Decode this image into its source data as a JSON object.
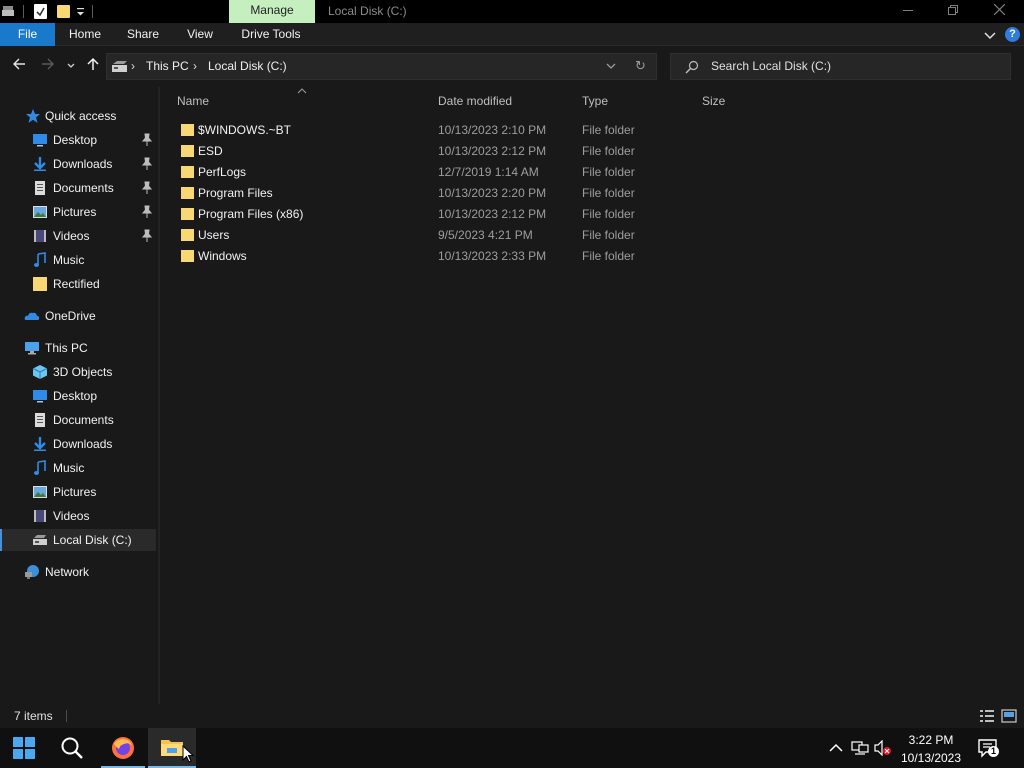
{
  "titlebar": {
    "manage_tab": "Manage",
    "window_title": "Local Disk (C:)"
  },
  "ribbon": {
    "tabs": [
      "File",
      "Home",
      "Share",
      "View",
      "Drive Tools"
    ],
    "help": "?"
  },
  "address": {
    "crumbs": [
      "This PC",
      "Local Disk (C:)"
    ],
    "search_placeholder": "Search Local Disk (C:)"
  },
  "sidebar": {
    "quick_access": "Quick access",
    "quick_items": [
      {
        "label": "Desktop",
        "icon": "desktop-icon",
        "pinned": true
      },
      {
        "label": "Downloads",
        "icon": "downloads-icon",
        "pinned": true
      },
      {
        "label": "Documents",
        "icon": "documents-icon",
        "pinned": true
      },
      {
        "label": "Pictures",
        "icon": "pictures-icon",
        "pinned": true
      },
      {
        "label": "Videos",
        "icon": "videos-icon",
        "pinned": true
      },
      {
        "label": "Music",
        "icon": "music-icon",
        "pinned": false
      },
      {
        "label": "Rectified",
        "icon": "folder-icon",
        "pinned": false
      }
    ],
    "onedrive": "OneDrive",
    "this_pc": "This PC",
    "pc_items": [
      {
        "label": "3D Objects",
        "icon": "3d-objects-icon"
      },
      {
        "label": "Desktop",
        "icon": "desktop-icon"
      },
      {
        "label": "Documents",
        "icon": "documents-icon"
      },
      {
        "label": "Downloads",
        "icon": "downloads-icon"
      },
      {
        "label": "Music",
        "icon": "music-icon"
      },
      {
        "label": "Pictures",
        "icon": "pictures-icon"
      },
      {
        "label": "Videos",
        "icon": "videos-icon"
      },
      {
        "label": "Local Disk (C:)",
        "icon": "drive-icon",
        "selected": true
      }
    ],
    "network": "Network"
  },
  "columns": {
    "name": "Name",
    "date": "Date modified",
    "type": "Type",
    "size": "Size"
  },
  "files": [
    {
      "name": "$WINDOWS.~BT",
      "date": "10/13/2023 2:10 PM",
      "type": "File folder"
    },
    {
      "name": "ESD",
      "date": "10/13/2023 2:12 PM",
      "type": "File folder"
    },
    {
      "name": "PerfLogs",
      "date": "12/7/2019 1:14 AM",
      "type": "File folder"
    },
    {
      "name": "Program Files",
      "date": "10/13/2023 2:20 PM",
      "type": "File folder"
    },
    {
      "name": "Program Files (x86)",
      "date": "10/13/2023 2:12 PM",
      "type": "File folder"
    },
    {
      "name": "Users",
      "date": "9/5/2023 4:21 PM",
      "type": "File folder"
    },
    {
      "name": "Windows",
      "date": "10/13/2023 2:33 PM",
      "type": "File folder"
    }
  ],
  "status": {
    "items_count": "7 items"
  },
  "taskbar": {
    "time": "3:22 PM",
    "date": "10/13/2023",
    "notification_count": "1"
  },
  "colors": {
    "folder": "#f8d775",
    "accent": "#1979ca",
    "manage_tab": "#c6efc0"
  }
}
